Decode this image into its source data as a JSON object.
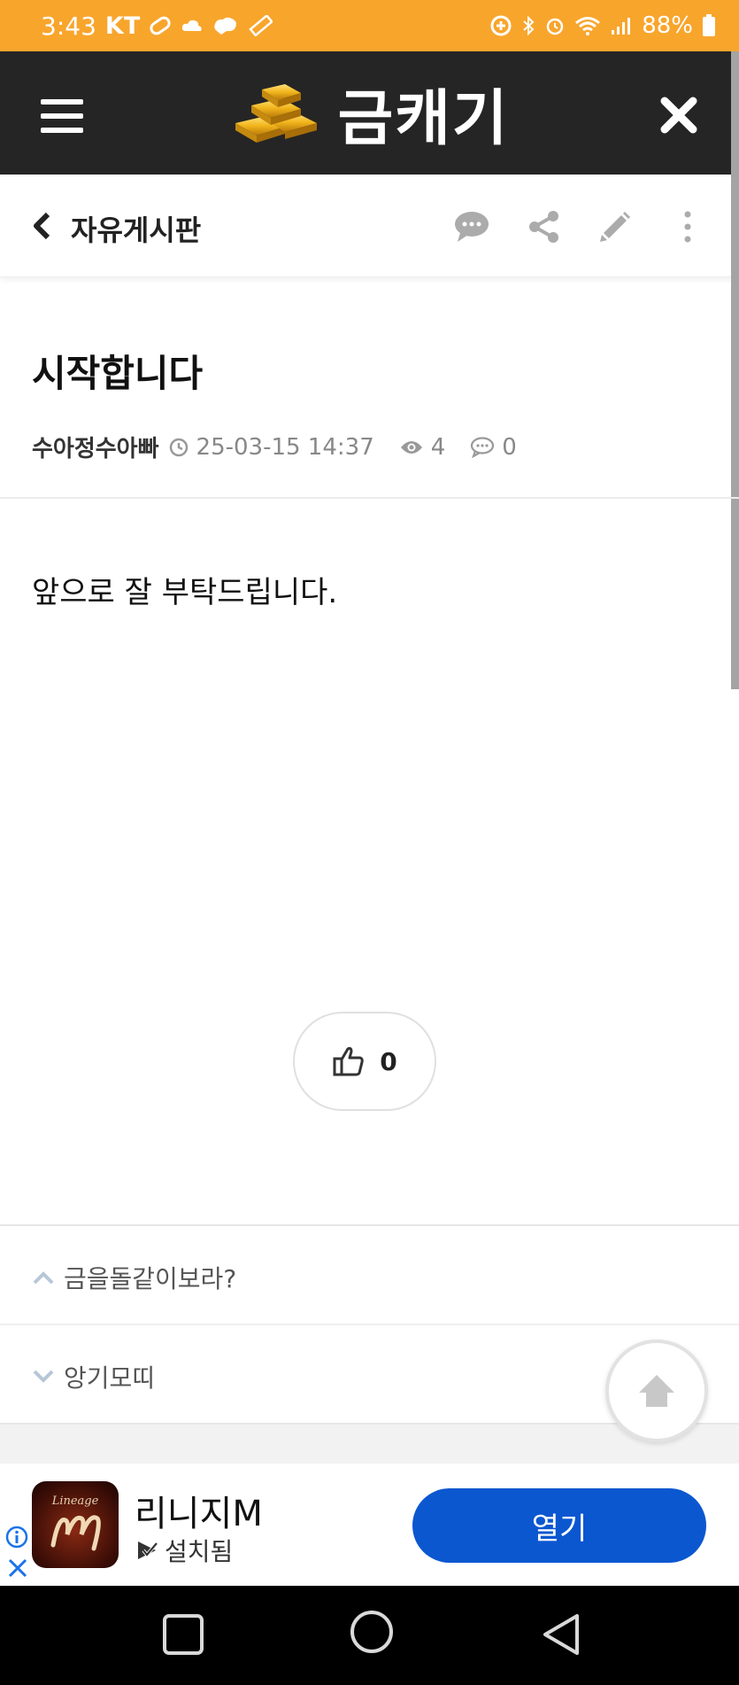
{
  "status_bar": {
    "time": "3:43",
    "carrier": "KT",
    "battery": "88%"
  },
  "header": {
    "site_title": "금캐기"
  },
  "board_nav": {
    "board_name": "자유게시판"
  },
  "post": {
    "title": "시작합니다",
    "author": "수아정수아빠",
    "datetime": "25-03-15 14:37",
    "views": "4",
    "comments": "0",
    "body": "앞으로 잘 부탁드립니다.",
    "likes": "0"
  },
  "post_nav": {
    "prev_title": "금을돌같이보라?",
    "next_title": "앙기모띠"
  },
  "ad": {
    "app_name": "리니지M",
    "status": "설치됨",
    "open_label": "열기",
    "logo_text": "Lineage"
  },
  "colors": {
    "status_bar": "#f8a52c",
    "header_bg": "#252525",
    "ad_button": "#0b57d0"
  }
}
